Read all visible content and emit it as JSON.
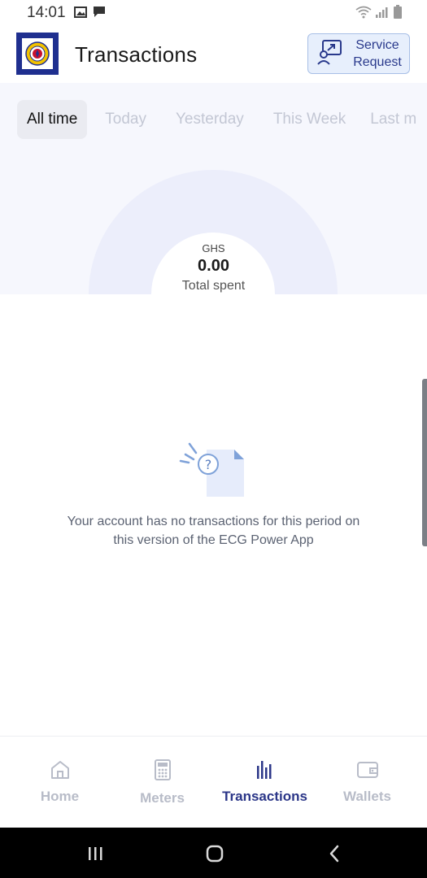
{
  "status_bar": {
    "time": "14:01",
    "left_icons": [
      "image-icon",
      "message-icon"
    ],
    "right_icons": [
      "wifi-icon",
      "signal-icon",
      "battery-icon"
    ]
  },
  "header": {
    "title": "Transactions",
    "logo": "ecg-logo",
    "service_request_label": "Service Request"
  },
  "filters": {
    "tabs": [
      "All time",
      "Today",
      "Yesterday",
      "This Week",
      "Last m"
    ],
    "active_index": 0
  },
  "summary": {
    "currency": "GHS",
    "value": "0.00",
    "label": "Total spent"
  },
  "empty_state": {
    "icon": "empty-document-icon",
    "message": "Your account has no transactions for this period on this version of the ECG Power App"
  },
  "bottom_nav": {
    "items": [
      {
        "label": "Home",
        "icon": "home-icon"
      },
      {
        "label": "Meters",
        "icon": "calculator-icon"
      },
      {
        "label": "Transactions",
        "icon": "bar-chart-icon"
      },
      {
        "label": "Wallets",
        "icon": "wallet-icon"
      }
    ],
    "active_index": 2
  },
  "system_nav": [
    "recent-apps-icon",
    "home-button-icon",
    "back-icon"
  ],
  "colors": {
    "brand_navy": "#1f2f8f",
    "accent_active": "#2b3688",
    "service_button_bg": "#e7effc",
    "summary_bg": "#f6f7fd",
    "gauge_arc": "#eceefb",
    "inactive_text": "#c3c7d4"
  }
}
